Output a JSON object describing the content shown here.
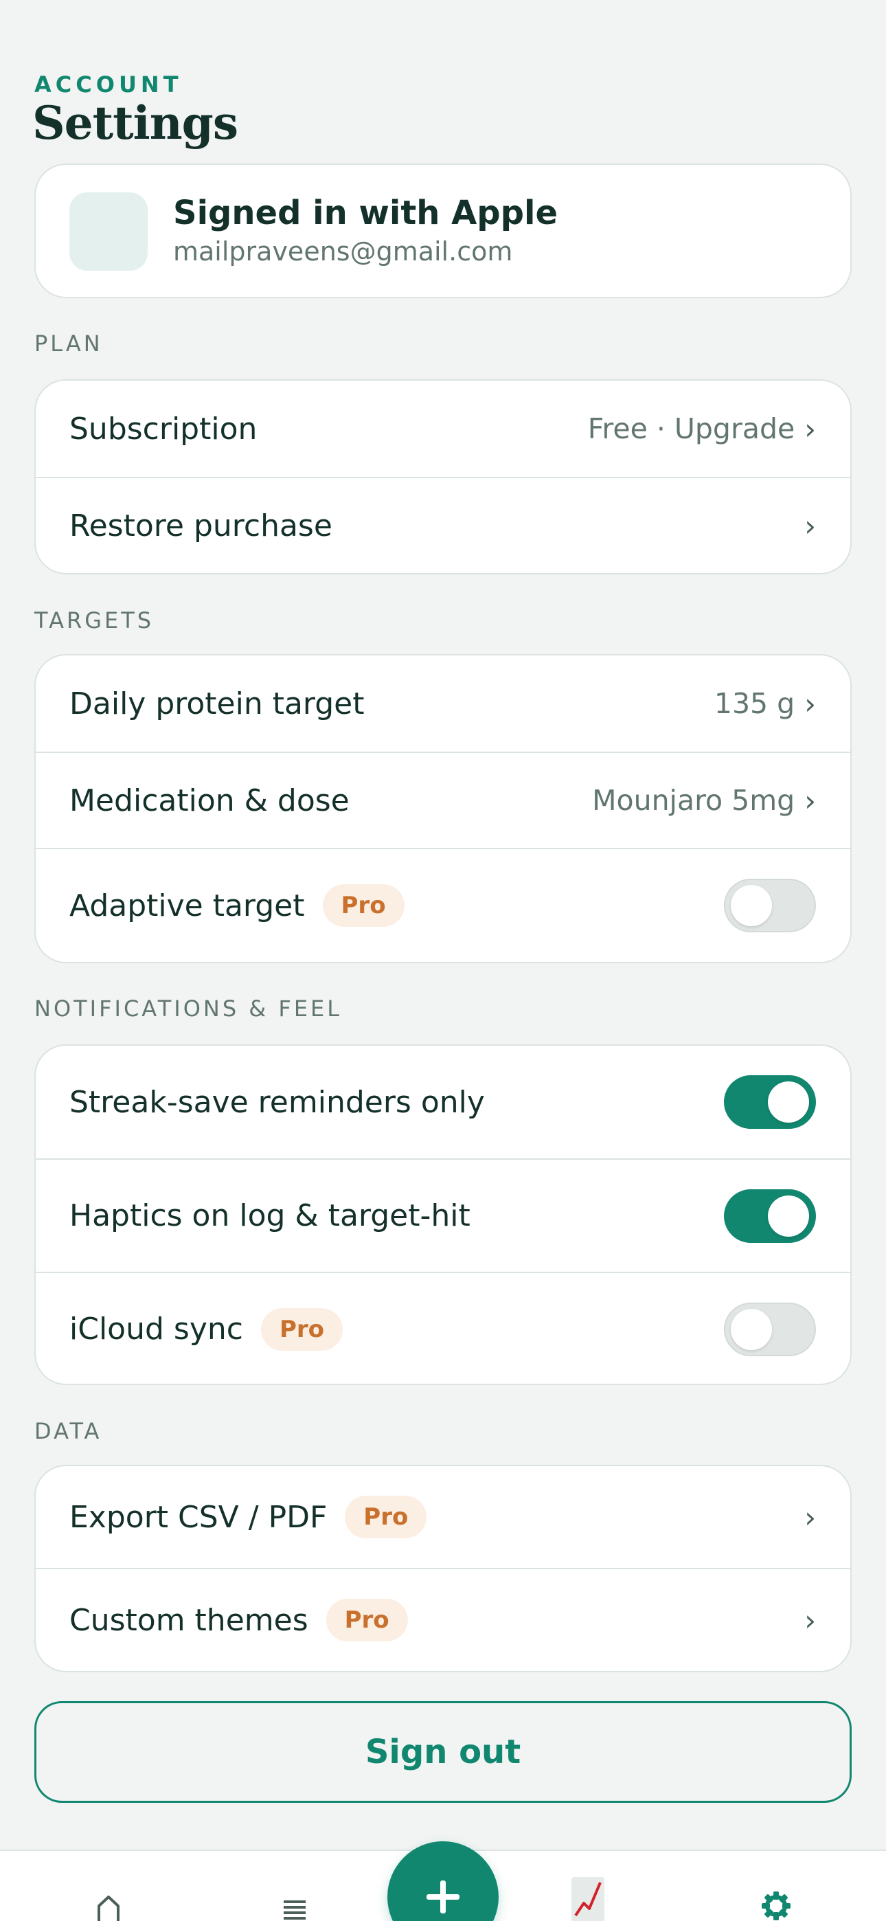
{
  "header": {
    "eyebrow": "ACCOUNT",
    "title": "Settings"
  },
  "account": {
    "title": "Signed in with Apple",
    "email": "mailpraveens@gmail.com"
  },
  "sections": {
    "plan": {
      "label": "PLAN",
      "subscription": {
        "label": "Subscription",
        "value": "Free · Upgrade"
      },
      "restore": {
        "label": "Restore purchase"
      }
    },
    "targets": {
      "label": "TARGETS",
      "protein": {
        "label": "Daily protein target",
        "value": "135 g"
      },
      "medication": {
        "label": "Medication & dose",
        "value": "Mounjaro 5mg"
      },
      "adaptive": {
        "label": "Adaptive target",
        "badge": "Pro",
        "enabled": false
      }
    },
    "notifications": {
      "label": "NOTIFICATIONS & FEEL",
      "streak": {
        "label": "Streak-save reminders only",
        "enabled": true
      },
      "haptics": {
        "label": "Haptics on log & target-hit",
        "enabled": true
      },
      "icloud": {
        "label": "iCloud sync",
        "badge": "Pro",
        "enabled": false
      }
    },
    "data": {
      "label": "DATA",
      "export": {
        "label": "Export CSV / PDF",
        "badge": "Pro"
      },
      "themes": {
        "label": "Custom themes",
        "badge": "Pro"
      }
    }
  },
  "chevron": "›",
  "signout_label": "Sign out",
  "tabbar": {
    "items": [
      "home-icon",
      "list-icon",
      "add-icon",
      "chart-icon",
      "gear-icon"
    ],
    "active": "gear-icon"
  },
  "colors": {
    "accent": "#11876f",
    "background": "#f1f4f3",
    "pro_badge_bg": "#fbeee2",
    "pro_badge_text": "#c8702c"
  }
}
